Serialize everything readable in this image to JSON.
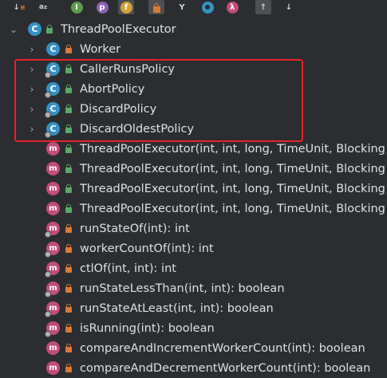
{
  "toolbar": {
    "icons": [
      {
        "name": "sort-visibility-icon",
        "glyph": "↓"
      },
      {
        "name": "sort-alpha-icon",
        "glyph": "az"
      },
      {
        "name": "show-inherited-icon",
        "glyph": "I"
      },
      {
        "name": "show-properties-icon",
        "glyph": "p"
      },
      {
        "name": "show-fields-icon",
        "glyph": "f"
      },
      {
        "name": "show-non-public-icon",
        "glyph": ""
      },
      {
        "name": "show-lambdas-icon",
        "glyph": "Y"
      },
      {
        "name": "show-anonymous-icon",
        "glyph": ""
      },
      {
        "name": "show-lambda-icon",
        "glyph": "λ"
      },
      {
        "name": "autoscroll-to-source-icon",
        "glyph": "↑"
      },
      {
        "name": "autoscroll-from-source-icon",
        "glyph": "↓"
      }
    ]
  },
  "tree": {
    "root": {
      "label": "ThreadPoolExecutor",
      "icon": "class-icon",
      "expanded": true
    },
    "classes": [
      {
        "label": "Worker",
        "visibility": "private"
      },
      {
        "label": "CallerRunsPolicy",
        "visibility": "public"
      },
      {
        "label": "AbortPolicy",
        "visibility": "public"
      },
      {
        "label": "DiscardPolicy",
        "visibility": "public"
      },
      {
        "label": "DiscardOldestPolicy",
        "visibility": "public"
      }
    ],
    "methods": [
      {
        "label": "ThreadPoolExecutor(int, int, long, TimeUnit, Blocking",
        "visibility": "public"
      },
      {
        "label": "ThreadPoolExecutor(int, int, long, TimeUnit, Blocking",
        "visibility": "public"
      },
      {
        "label": "ThreadPoolExecutor(int, int, long, TimeUnit, Blocking",
        "visibility": "public"
      },
      {
        "label": "ThreadPoolExecutor(int, int, long, TimeUnit, Blocking",
        "visibility": "public"
      },
      {
        "label": "runStateOf(int): int",
        "visibility": "private"
      },
      {
        "label": "workerCountOf(int): int",
        "visibility": "private"
      },
      {
        "label": "ctlOf(int, int): int",
        "visibility": "private"
      },
      {
        "label": "runStateLessThan(int, int): boolean",
        "visibility": "private"
      },
      {
        "label": "runStateAtLeast(int, int): boolean",
        "visibility": "private"
      },
      {
        "label": "isRunning(int): boolean",
        "visibility": "private"
      },
      {
        "label": "compareAndIncrementWorkerCount(int): boolean",
        "visibility": "private"
      },
      {
        "label": "compareAndDecrementWorkerCount(int): boolean",
        "visibility": "private"
      }
    ]
  },
  "colors": {
    "background": "#2b2d30",
    "text": "#dfe1e5",
    "class_icon": "#3592c4",
    "method_icon": "#c24d7a",
    "public_lock": "#59a869",
    "private_lock": "#d9793a",
    "highlight": "#e8232b"
  }
}
